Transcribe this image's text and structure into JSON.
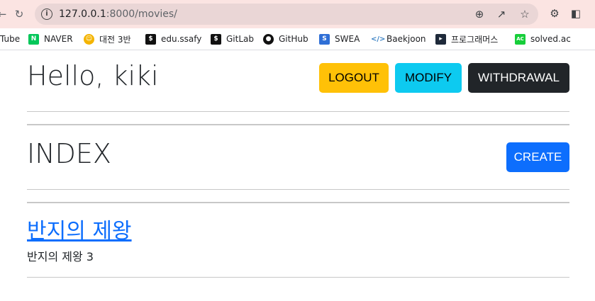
{
  "browser": {
    "url_host": "127.0.0.1",
    "url_path": ":8000/movies/",
    "bookmarks": [
      {
        "label": "Tube",
        "icon": "youtube-icon"
      },
      {
        "label": "NAVER",
        "icon": "naver-icon",
        "color": "#03c75a"
      },
      {
        "label": "대전 3반",
        "icon": "emoji-icon"
      },
      {
        "label": "edu.ssafy",
        "icon": "ssafy-icon"
      },
      {
        "label": "GitLab",
        "icon": "gitlab-icon"
      },
      {
        "label": "GitHub",
        "icon": "github-icon"
      },
      {
        "label": "SWEA",
        "icon": "swea-icon",
        "color": "#2f6fd6"
      },
      {
        "label": "Baekjoon",
        "icon": "baekjoon-icon"
      },
      {
        "label": "프로그래머스",
        "icon": "programmers-icon"
      },
      {
        "label": "solved.ac",
        "icon": "solvedac-icon",
        "color": "#17ce3a"
      }
    ]
  },
  "header": {
    "greeting": "Hello, kiki",
    "logout_label": "LOGOUT",
    "modify_label": "MODIFY",
    "withdrawal_label": "WITHDRAWAL"
  },
  "index": {
    "title": "INDEX",
    "create_label": "CREATE"
  },
  "movies": [
    {
      "title": "반지의 제왕",
      "description": "반지의 제왕 3"
    }
  ],
  "colors": {
    "logout": "#ffc107",
    "modify": "#0dcaf0",
    "withdrawal": "#212529",
    "create": "#0d6efd",
    "link": "#0d6efd"
  }
}
